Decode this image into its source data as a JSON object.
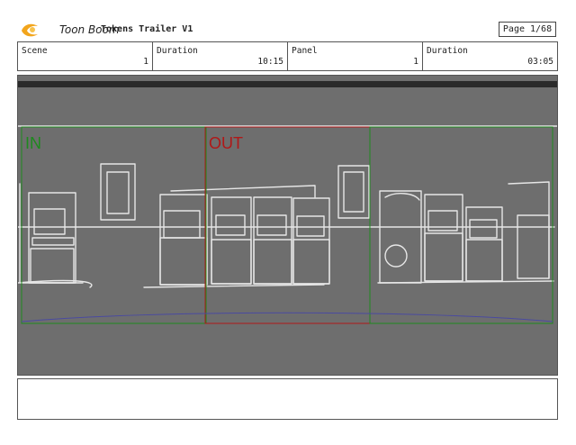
{
  "header": {
    "brand": "Toon Boom",
    "title": "Tokens Trailer V1",
    "page": "Page  1/68"
  },
  "meta": {
    "scene_label": "Scene",
    "scene_value": "1",
    "duration_label": "Duration",
    "duration_value": "10:15",
    "panel_label": "Panel",
    "panel_value": "1",
    "panel_duration_label": "Duration",
    "panel_duration_value": "03:05"
  },
  "panel": {
    "in_label": "IN",
    "out_label": "OUT",
    "in_color": "#1e8a1e",
    "out_color": "#b01818"
  },
  "notes": {
    "text": ""
  }
}
